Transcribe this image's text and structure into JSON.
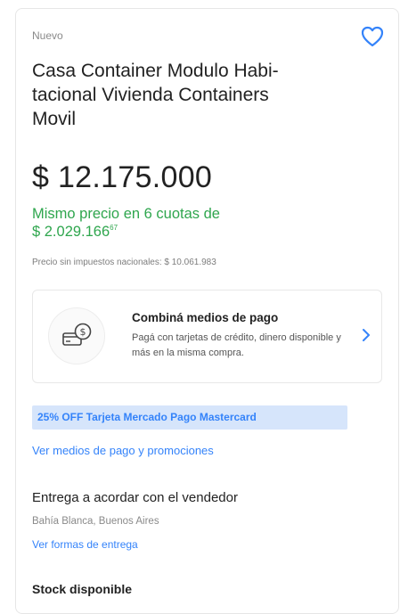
{
  "product": {
    "condition": "Nuevo",
    "title": "Casa Container Modulo Habi-tacional Vivienda Containers Movil",
    "title_lines": [
      "Casa Container Modulo Habi-",
      "tacional Vivienda Containers",
      "Movil"
    ],
    "price": "$ 12.175.000",
    "installments_line1": "Mismo precio en 6 cuotas de",
    "installments_amount": "$ 2.029.166",
    "installments_cents": "67",
    "tax_note": "Precio sin impuestos nacionales: $ 10.061.983"
  },
  "payment_box": {
    "title": "Combiná medios de pago",
    "description": "Pagá con tarjetas de crédito, dinero disponible y más en la misma compra."
  },
  "promo": {
    "label": "25% OFF Tarjeta Mercado Pago Mastercard"
  },
  "links": {
    "see_payments": "Ver medios de pago y promociones",
    "see_delivery": "Ver formas de entrega"
  },
  "delivery": {
    "title": "Entrega a acordar con el vendedor",
    "location": "Bahía Blanca, Buenos Aires"
  },
  "stock": {
    "label": "Stock disponible"
  },
  "icons": {
    "favorite": "heart-icon",
    "payment": "money-card-icon",
    "chevron": "chevron-right-icon"
  },
  "colors": {
    "accent": "#3483fa",
    "success": "#2fa64e",
    "promo_bg": "#d6e5fb"
  }
}
